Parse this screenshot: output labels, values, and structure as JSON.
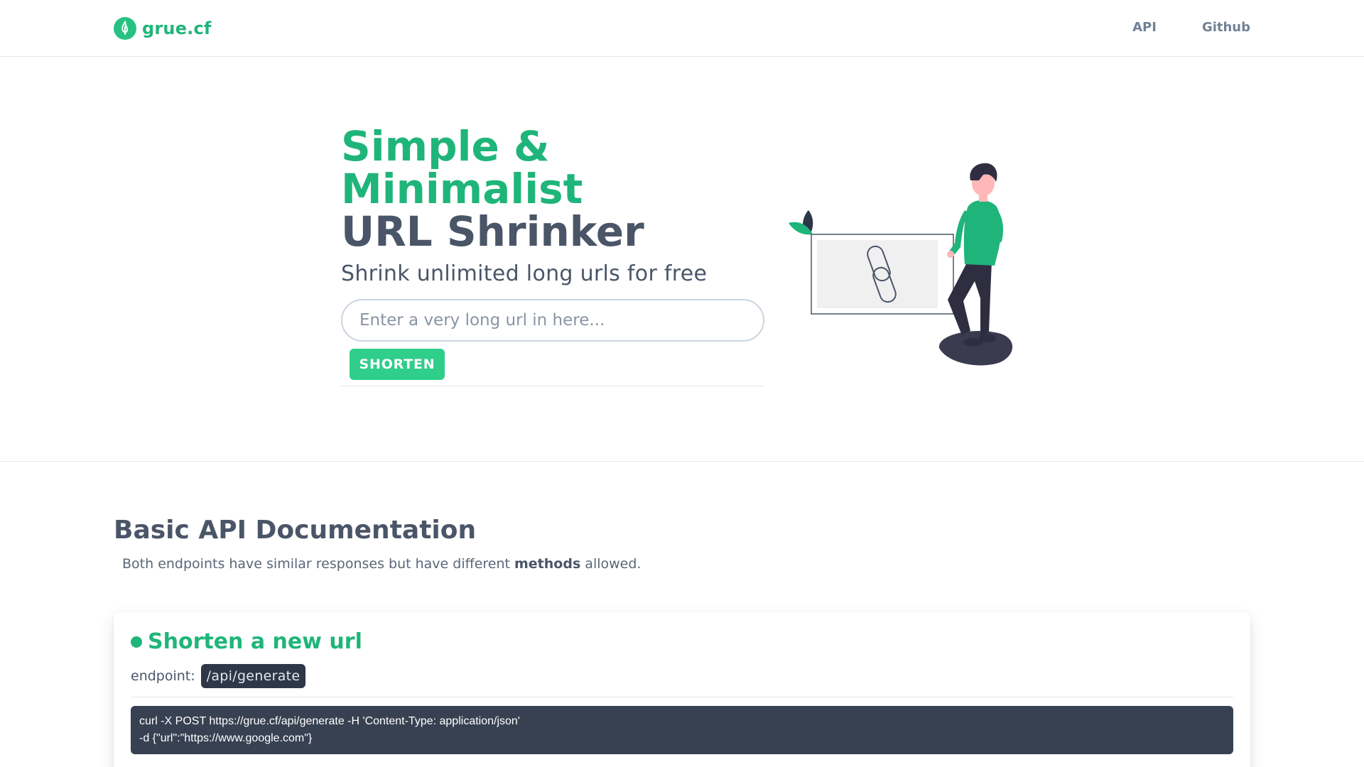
{
  "header": {
    "brand": "grue.cf",
    "nav": [
      {
        "label": "API"
      },
      {
        "label": "Github"
      }
    ]
  },
  "hero": {
    "title_line1": "Simple &",
    "title_line2": "Minimalist",
    "title_line3": "URL Shrinker",
    "subtitle": "Shrink unlimited long urls for free",
    "input_placeholder": "Enter a very long url in here...",
    "input_value": "",
    "button_label": "SHORTEN"
  },
  "docs": {
    "title": "Basic API Documentation",
    "desc_before": "Both endpoints have similar responses but have different ",
    "desc_bold": "methods",
    "desc_after": " allowed.",
    "card": {
      "title": "Shorten a new url",
      "endpoint_label": "endpoint:",
      "endpoint": "/api/generate",
      "code_line1": "curl -X POST https://grue.cf/api/generate -H 'Content-Type: application/json'",
      "code_line2": "-d {\"url\":\"https://www.google.com\"}"
    }
  },
  "colors": {
    "accent": "#1fb57a",
    "text": "#4a5568",
    "code_bg": "#374151"
  },
  "icons": {
    "logo": "leaf-drop-icon",
    "illustration": "person-with-link-board"
  }
}
